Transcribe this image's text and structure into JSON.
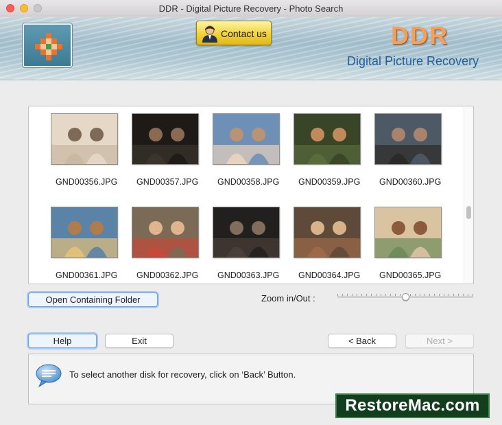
{
  "window": {
    "title": "DDR - Digital Picture Recovery - Photo Search"
  },
  "header": {
    "contact_label": "Contact us",
    "brand": "DDR",
    "brand_subtitle": "Digital Picture Recovery",
    "brand_color": "#f2a05e",
    "subtitle_color": "#1f5f9c"
  },
  "files": [
    {
      "name": "GND00356.JPG"
    },
    {
      "name": "GND00357.JPG"
    },
    {
      "name": "GND00358.JPG"
    },
    {
      "name": "GND00359.JPG"
    },
    {
      "name": "GND00360.JPG"
    },
    {
      "name": "GND00361.JPG"
    },
    {
      "name": "GND00362.JPG"
    },
    {
      "name": "GND00363.JPG"
    },
    {
      "name": "GND00364.JPG"
    },
    {
      "name": "GND00365.JPG"
    }
  ],
  "actions": {
    "open_folder": "Open Containing Folder",
    "zoom_label": "Zoom in/Out :",
    "zoom_level": 0.5,
    "help": "Help",
    "exit": "Exit",
    "back": "< Back",
    "next": "Next >"
  },
  "message": {
    "text": "To select another disk for recovery, click on ‘Back’ Button."
  },
  "watermark": {
    "text": "RestoreMac.com"
  }
}
